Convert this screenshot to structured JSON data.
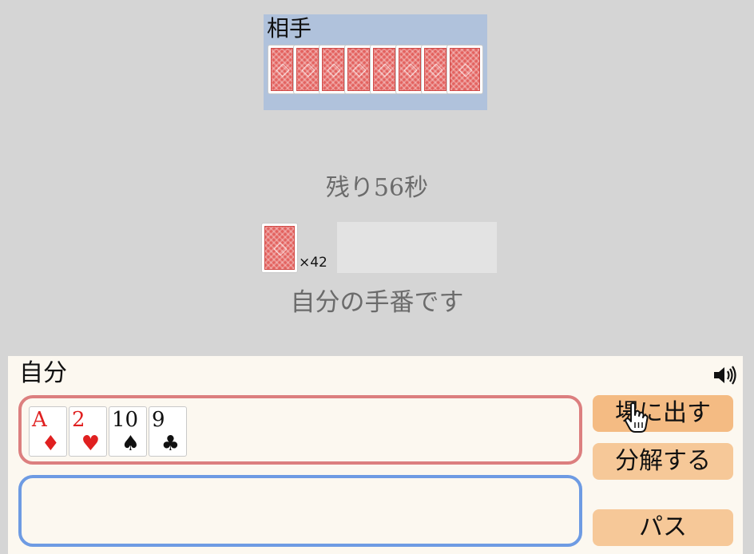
{
  "opponent": {
    "label": "相手",
    "card_count": 8
  },
  "timer": "残り56秒",
  "deck": {
    "count_label": "×42"
  },
  "turn_status": "自分の手番です",
  "player": {
    "label": "自分",
    "hand": [
      {
        "rank": "A",
        "suit": "♦",
        "color": "red"
      },
      {
        "rank": "2",
        "suit": "♥",
        "color": "red"
      },
      {
        "rank": "10",
        "suit": "♠",
        "color": "black"
      },
      {
        "rank": "9",
        "suit": "♣",
        "color": "black"
      }
    ]
  },
  "buttons": {
    "play": "場に出す",
    "split": "分解する",
    "pass": "パス"
  },
  "icons": {
    "sound": "speaker-icon",
    "cursor": "hand-pointer-icon"
  },
  "colors": {
    "opponent_area": "#b0c2dc",
    "hand_border": "#dc7f7f",
    "selected_border": "#6e9be3",
    "button": "#f6c898",
    "card_back": "#e3625f"
  }
}
